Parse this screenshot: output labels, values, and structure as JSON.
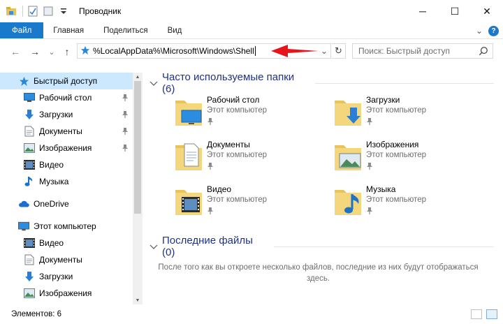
{
  "window": {
    "title": "Проводник",
    "controls": {
      "minimize": "─",
      "maximize": "☐",
      "close": "✕"
    }
  },
  "ribbon": {
    "tabs": [
      "Файл",
      "Главная",
      "Поделиться",
      "Вид"
    ],
    "expand_glyph": "⌄",
    "help": "?"
  },
  "nav_buttons": {
    "back": "←",
    "forward": "→",
    "history": "⌄",
    "up": "↑"
  },
  "address": {
    "value": "%LocalAppData%\\Microsoft\\Windows\\Shell",
    "dropdown": "⌄",
    "refresh": "↻"
  },
  "search": {
    "placeholder": "Поиск: Быстрый доступ"
  },
  "navigation_pane": {
    "items": [
      {
        "label": "Быстрый доступ",
        "icon": "star-icon",
        "level": 0,
        "selected": true,
        "pinned": false
      },
      {
        "label": "Рабочий стол",
        "icon": "desktop-icon",
        "level": 1,
        "pinned": true
      },
      {
        "label": "Загрузки",
        "icon": "download-icon",
        "level": 1,
        "pinned": true
      },
      {
        "label": "Документы",
        "icon": "document-icon",
        "level": 1,
        "pinned": true
      },
      {
        "label": "Изображения",
        "icon": "pictures-icon",
        "level": 1,
        "pinned": true
      },
      {
        "label": "Видео",
        "icon": "video-icon",
        "level": 1,
        "pinned": false
      },
      {
        "label": "Музыка",
        "icon": "music-icon",
        "level": 1,
        "pinned": false
      },
      {
        "label": "OneDrive",
        "icon": "cloud-icon",
        "level": 0,
        "pinned": false,
        "gap_before": true
      },
      {
        "label": "Этот компьютер",
        "icon": "computer-icon",
        "level": 0,
        "pinned": false,
        "gap_before": true
      },
      {
        "label": "Видео",
        "icon": "video-icon",
        "level": 1,
        "pinned": false
      },
      {
        "label": "Документы",
        "icon": "document-icon",
        "level": 1,
        "pinned": false
      },
      {
        "label": "Загрузки",
        "icon": "download-icon",
        "level": 1,
        "pinned": false
      },
      {
        "label": "Изображения",
        "icon": "pictures-icon",
        "level": 1,
        "pinned": false
      }
    ]
  },
  "frequent": {
    "header": "Часто используемые папки (6)",
    "folders": [
      {
        "name": "Рабочий стол",
        "location": "Этот компьютер",
        "overlay": "desktop"
      },
      {
        "name": "Загрузки",
        "location": "Этот компьютер",
        "overlay": "download"
      },
      {
        "name": "Документы",
        "location": "Этот компьютер",
        "overlay": "document"
      },
      {
        "name": "Изображения",
        "location": "Этот компьютер",
        "overlay": "pictures"
      },
      {
        "name": "Видео",
        "location": "Этот компьютер",
        "overlay": "video"
      },
      {
        "name": "Музыка",
        "location": "Этот компьютер",
        "overlay": "music"
      }
    ]
  },
  "recent": {
    "header": "Последние файлы (0)",
    "empty_text": "После того как вы откроете несколько файлов, последние из них будут отображаться здесь."
  },
  "status": {
    "text": "Элементов: 6"
  },
  "colors": {
    "accent": "#1979ca",
    "selection": "#cce8ff",
    "group_header": "#1e3287",
    "folder": "#e8c25a",
    "arrow": "#e8141c"
  }
}
